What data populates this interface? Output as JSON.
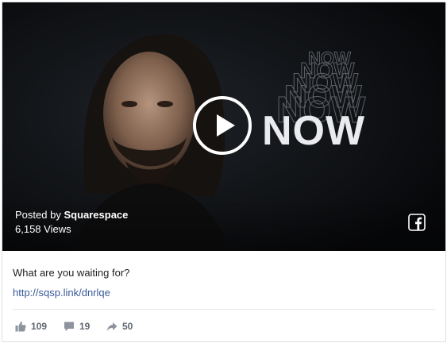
{
  "video": {
    "overlay_word": "NOW",
    "posted_prefix": "Posted by",
    "posted_by": "Squarespace",
    "views": "6,158 Views"
  },
  "post": {
    "caption": "What are you waiting for?",
    "link": "http://sqsp.link/dnrlqe"
  },
  "stats": {
    "likes": "109",
    "comments": "19",
    "shares": "50"
  },
  "icons": {
    "play": "play-icon",
    "facebook": "facebook-icon",
    "like": "thumbs-up-icon",
    "comment": "comment-icon",
    "share": "share-icon"
  },
  "colors": {
    "link": "#385898",
    "stat_text": "#606770",
    "video_bg": "#0b0c0e"
  }
}
